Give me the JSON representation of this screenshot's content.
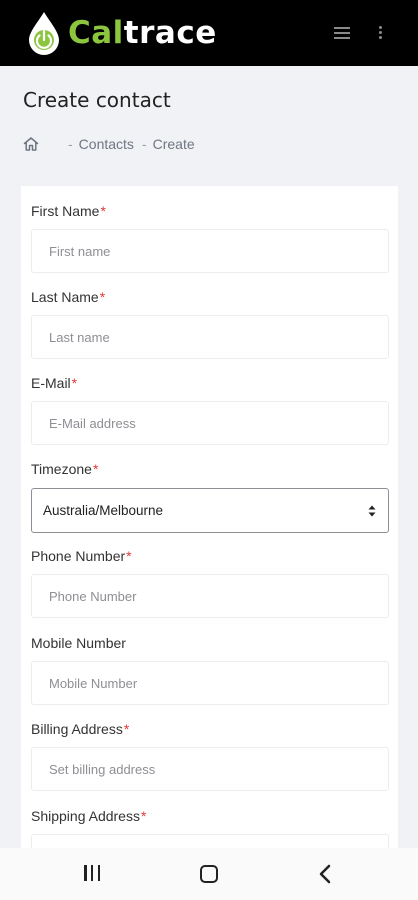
{
  "app": {
    "logo_part1": "Cal",
    "logo_part2": "trace",
    "brand_color": "#8cc63f",
    "header_bg": "#000000"
  },
  "header": {
    "menu_icon": "hamburger-menu-icon",
    "more_icon": "vertical-dots-icon"
  },
  "page": {
    "title": "Create contact"
  },
  "breadcrumb": {
    "home_icon": "home-icon",
    "items": [
      "Contacts",
      "Create"
    ],
    "separator": "-"
  },
  "form": {
    "required_marker": "*",
    "fields": [
      {
        "label": "First Name",
        "placeholder": "First name",
        "value": ""
      },
      {
        "label": "Last Name",
        "placeholder": "Last name",
        "value": ""
      },
      {
        "label": "E-Mail",
        "placeholder": "E-Mail address",
        "value": ""
      },
      {
        "label": "Timezone",
        "value": "Australia/Melbourne"
      },
      {
        "label": "Phone Number",
        "placeholder": "Phone Number",
        "value": ""
      },
      {
        "label": "Mobile Number",
        "placeholder": "Mobile Number",
        "value": ""
      },
      {
        "label": "Billing Address",
        "placeholder": "Set billing address",
        "value": ""
      },
      {
        "label": "Shipping Address",
        "placeholder": "",
        "value": ""
      }
    ]
  },
  "system_nav": {
    "recent_icon": "recent-apps-icon",
    "home_icon": "home-button-icon",
    "back_icon": "back-chevron-icon"
  }
}
